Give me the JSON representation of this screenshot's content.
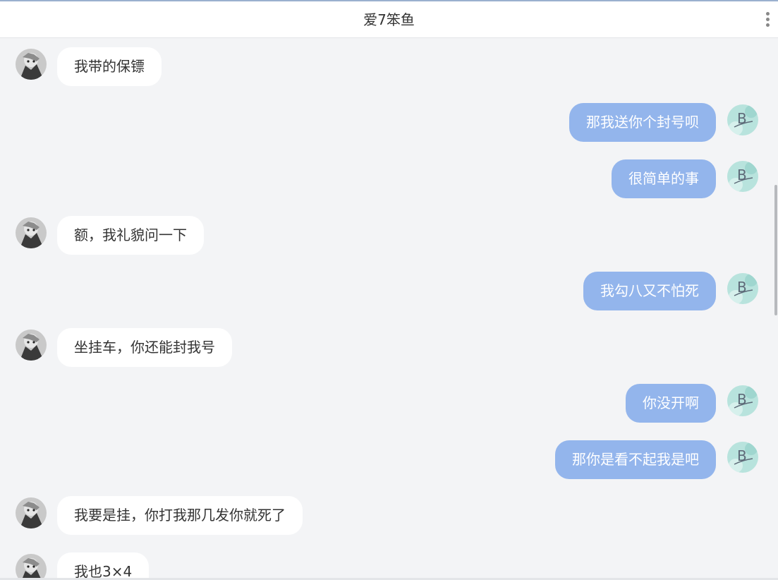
{
  "header": {
    "title": "爱7笨鱼",
    "more_icon": "more-vertical-icon"
  },
  "colors": {
    "background": "#f3f4f6",
    "self_bubble": "#93b5ec",
    "other_bubble": "#ffffff"
  },
  "messages": [
    {
      "from": "other",
      "text": "我带的保镖"
    },
    {
      "from": "self",
      "text": "那我送你个封号呗"
    },
    {
      "from": "self",
      "text": "很简单的事"
    },
    {
      "from": "other",
      "text": "额，我礼貌问一下"
    },
    {
      "from": "self",
      "text": "我勾八又不怕死"
    },
    {
      "from": "other",
      "text": "坐挂车，你还能封我号"
    },
    {
      "from": "self",
      "text": "你没开啊"
    },
    {
      "from": "self",
      "text": "那你是看不起我是吧"
    },
    {
      "from": "other",
      "text": "我要是挂，你打我那几发你就死了"
    },
    {
      "from": "other",
      "text": "我也3×4"
    }
  ]
}
